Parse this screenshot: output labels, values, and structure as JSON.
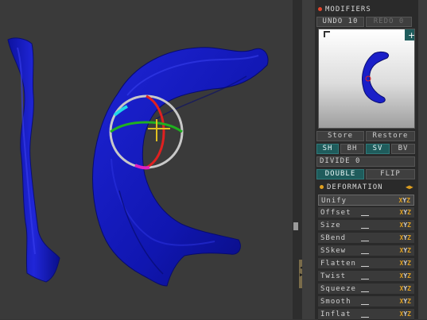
{
  "panel": {
    "title": "MODIFIERS",
    "undo_label": "UNDO 10",
    "redo_label": "REDO 0",
    "thumb_corner_icon": "plus-icon",
    "thumb_left_icon": "rotate-arrow-icon",
    "store_label": "Store",
    "restore_label": "Restore",
    "sh_label": "SH",
    "bh_label": "BH",
    "sv_label": "SV",
    "bv_label": "BV",
    "divide_label": "DIVIDE",
    "divide_value": "0",
    "double_label": "DOUBLE",
    "flip_label": "FLIP"
  },
  "deformation": {
    "title": "DEFORMATION",
    "items": [
      {
        "label": "Unify"
      },
      {
        "label": "Offset"
      },
      {
        "label": "Size"
      },
      {
        "label": "SBend"
      },
      {
        "label": "SSkew"
      },
      {
        "label": "Flatten"
      },
      {
        "label": "Twist"
      },
      {
        "label": "Squeeze"
      },
      {
        "label": "Smooth"
      },
      {
        "label": "Inflat"
      }
    ],
    "axis_labels": [
      "X",
      "Y",
      "Z"
    ]
  },
  "colors": {
    "accent_teal": "#1f5c5c",
    "axis_orange": "#e0a020",
    "mesh_blue": "#1a1fc8",
    "record_red": "#e5452a"
  }
}
